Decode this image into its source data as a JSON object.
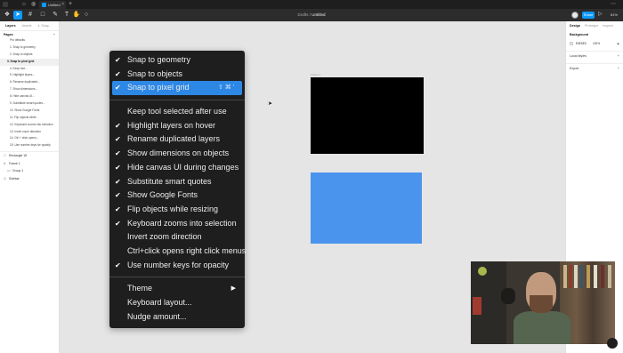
{
  "window": {
    "tab_title": "Untitled",
    "close_glyph": "×",
    "add_tab_glyph": "+"
  },
  "toolbar": {
    "project": "Drafts",
    "separator": "/",
    "file_name": "Untitled",
    "share_label": "Share",
    "zoom": "81%",
    "tool_icons": [
      "figma-menu-icon",
      "move-tool-icon",
      "frame-tool-icon",
      "shape-tool-icon",
      "pen-tool-icon",
      "text-tool-icon",
      "hand-tool-icon",
      "comment-tool-icon"
    ]
  },
  "left_panel": {
    "tabs": [
      "Layers",
      "Assets",
      "4. Snap..."
    ],
    "pages_heading": "Pages",
    "add_glyph": "+",
    "pages": [
      "Pro defaults",
      "1. Snap to geometry",
      "2. Snap to objects",
      "3. Snap to pixel grid",
      "4. Keep tool...",
      "5. Highlight layers...",
      "6. Rename duplicated...",
      "7. Show dimensions...",
      "8. Hide canvas UI...",
      "9. Substitute smart quotes...",
      "10. Show Google Fonts",
      "11. Flip objects while...",
      "12. Keyboard zooms into selection",
      "13. Invert zoom direction",
      "14. Ctrl + click opens...",
      "15. Use number keys for opacity"
    ],
    "selected_page_index": 3,
    "layers": [
      {
        "name": "Rectangle 18",
        "icon": "rectangle-icon",
        "indent": false
      },
      {
        "name": "Frame 1",
        "icon": "frame-icon",
        "indent": false
      },
      {
        "name": "Group 1",
        "icon": "group-icon",
        "indent": true
      },
      {
        "name": "Sidebar",
        "icon": "component-icon",
        "indent": false
      }
    ]
  },
  "right_panel": {
    "tabs": [
      "Design",
      "Prototype",
      "Inspect"
    ],
    "background_heading": "Background",
    "background_hex": "E5E5E5",
    "background_opacity": "100%",
    "local_styles": "Local styles",
    "export": "Export",
    "add_glyph": "+"
  },
  "canvas": {
    "frame_label": "Frame 1",
    "colors": {
      "frame": "#000000",
      "rectangle": "#4A94EE",
      "canvas": "#E5E5E5"
    }
  },
  "context_menu": {
    "check_glyph": "✔",
    "groups": [
      [
        {
          "label": "Snap to geometry",
          "checked": true
        },
        {
          "label": "Snap to objects",
          "checked": true
        },
        {
          "label": "Snap to pixel grid",
          "checked": true,
          "highlighted": true,
          "shortcut": "⇧ ⌘ '"
        }
      ],
      [
        {
          "label": "Keep tool selected after use",
          "checked": false
        },
        {
          "label": "Highlight layers on hover",
          "checked": true
        },
        {
          "label": "Rename duplicated layers",
          "checked": true
        },
        {
          "label": "Show dimensions on objects",
          "checked": true
        },
        {
          "label": "Hide canvas UI during changes",
          "checked": true
        },
        {
          "label": "Substitute smart quotes",
          "checked": true
        },
        {
          "label": "Show Google Fonts",
          "checked": true
        },
        {
          "label": "Flip objects while resizing",
          "checked": true
        },
        {
          "label": "Keyboard zooms into selection",
          "checked": true
        },
        {
          "label": "Invert zoom direction",
          "checked": false
        },
        {
          "label": "Ctrl+click opens right click menus",
          "checked": false
        },
        {
          "label": "Use number keys for opacity",
          "checked": true
        }
      ],
      [
        {
          "label": "Theme",
          "submenu": true
        },
        {
          "label": "Keyboard layout...",
          "checked": false
        },
        {
          "label": "Nudge amount...",
          "checked": false
        }
      ]
    ]
  }
}
